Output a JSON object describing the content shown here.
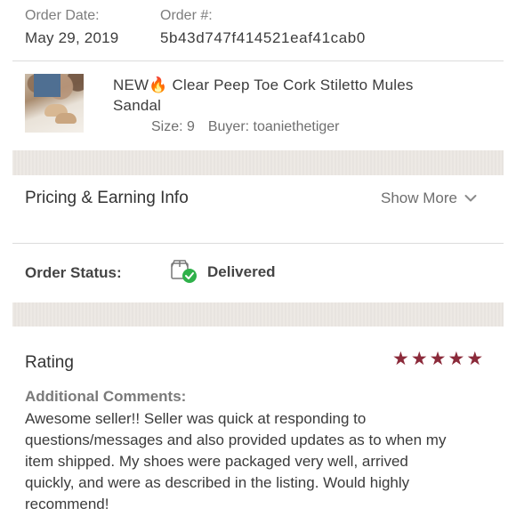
{
  "order": {
    "date_label": "Order Date:",
    "date_value": "May 29, 2019",
    "number_label": "Order #:",
    "number_value": "5b43d747f414521eaf41cab0"
  },
  "item": {
    "title_line1": "NEW🔥 Clear Peep Toe Cork Stiletto Mules",
    "title_line2": "Sandal",
    "size_label": "Size:",
    "size_value": "9",
    "buyer_label": "Buyer:",
    "buyer_value": "toaniethetiger"
  },
  "pricing": {
    "title": "Pricing & Earning Info",
    "show_more": "Show More"
  },
  "status": {
    "label": "Order Status:",
    "value": "Delivered"
  },
  "rating": {
    "title": "Rating",
    "stars": 5,
    "star_color": "#8b2a3a",
    "comments_label": "Additional Comments:",
    "comment_lines": [
      "Awesome seller!! Seller was quick at responding to",
      "questions/messages and also provided updates as to when my",
      "item shipped. My shoes were packaged very well, arrived",
      "quickly, and were as described in the listing. Would highly",
      "recommend!"
    ]
  },
  "colors": {
    "band": "#ece8e3",
    "accent_star": "#8b2a3a",
    "check_green": "#2fb14a"
  }
}
